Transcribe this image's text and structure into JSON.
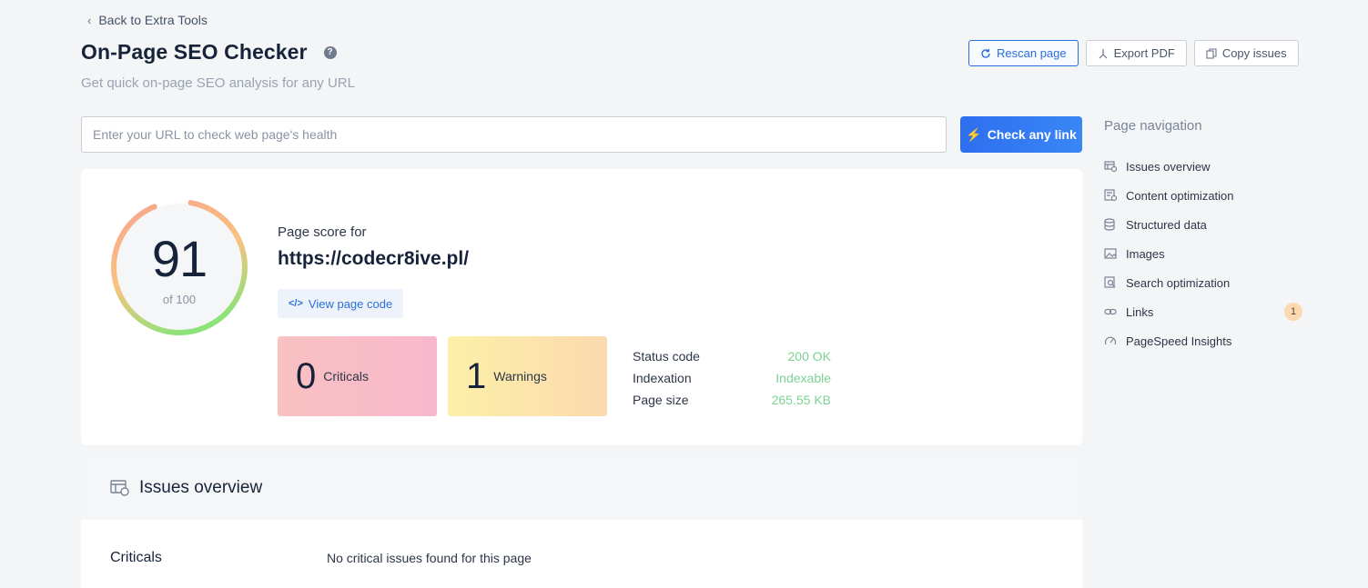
{
  "header": {
    "back_label": "Back to Extra Tools",
    "title": "On-Page SEO Checker",
    "subtitle": "Get quick on-page SEO analysis for any URL",
    "actions": {
      "rescan": "Rescan page",
      "export": "Export PDF",
      "copy": "Copy issues"
    }
  },
  "search": {
    "placeholder": "Enter your URL to check web page's health",
    "value": "",
    "button": "Check any link"
  },
  "score": {
    "value": "91",
    "of_label": "of 100",
    "fraction": 0.91,
    "for_label": "Page score for",
    "url": "https://codecr8ive.pl/",
    "view_code": "View page code",
    "criticals_count": "0",
    "criticals_label": "Criticals",
    "warnings_count": "1",
    "warnings_label": "Warnings",
    "meta": [
      {
        "key": "Status code",
        "value": "200 OK"
      },
      {
        "key": "Indexation",
        "value": "Indexable"
      },
      {
        "key": "Page size",
        "value": "265.55 KB"
      }
    ],
    "colors": {
      "gauge_start": "#f7a08f",
      "gauge_mid": "#f9c27f",
      "gauge_end": "#8de27a",
      "meta_value": "#7bd392"
    }
  },
  "issues": {
    "title": "Issues overview",
    "criticals_label": "Criticals",
    "criticals_message": "No critical issues found for this page"
  },
  "nav": {
    "title": "Page navigation",
    "items": [
      {
        "label": "Issues overview",
        "icon": "issues-icon",
        "badge": ""
      },
      {
        "label": "Content optimization",
        "icon": "content-icon",
        "badge": ""
      },
      {
        "label": "Structured data",
        "icon": "database-icon",
        "badge": ""
      },
      {
        "label": "Images",
        "icon": "image-icon",
        "badge": ""
      },
      {
        "label": "Search optimization",
        "icon": "search-doc-icon",
        "badge": ""
      },
      {
        "label": "Links",
        "icon": "link-icon",
        "badge": "1"
      },
      {
        "label": "PageSpeed Insights",
        "icon": "speed-icon",
        "badge": ""
      }
    ]
  },
  "accent_color": "#2a6edb"
}
